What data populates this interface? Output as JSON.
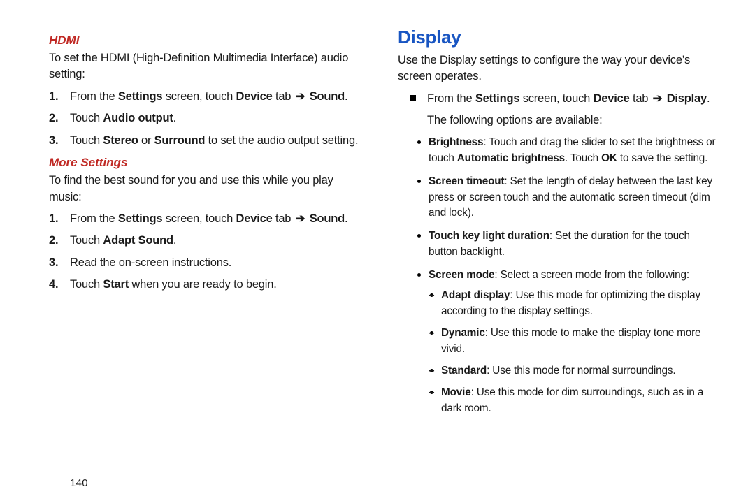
{
  "page_number": "140",
  "left": {
    "hdmi": {
      "heading": "HDMI",
      "intro": "To set the HDMI (High-Definition Multimedia Interface) audio setting:",
      "steps": [
        {
          "num": "1.",
          "pre": "From the ",
          "b1": "Settings",
          "mid1": " screen, touch ",
          "b2": "Device",
          "mid2": " tab ",
          "b3": "Sound",
          "post": "."
        },
        {
          "num": "2.",
          "pre": "Touch ",
          "b1": "Audio output",
          "post": "."
        },
        {
          "num": "3.",
          "pre": "Touch ",
          "b1": "Stereo",
          "mid1": " or ",
          "b2": "Surround",
          "post": " to set the audio output setting."
        }
      ]
    },
    "more": {
      "heading": "More Settings",
      "intro": "To find the best sound for you and use this while you play music:",
      "steps": [
        {
          "num": "1.",
          "pre": "From the ",
          "b1": "Settings",
          "mid1": " screen, touch ",
          "b2": "Device",
          "mid2": " tab ",
          "b3": "Sound",
          "post": "."
        },
        {
          "num": "2.",
          "pre": "Touch ",
          "b1": "Adapt Sound",
          "post": "."
        },
        {
          "num": "3.",
          "pre": "Read the on-screen instructions.",
          "post": ""
        },
        {
          "num": "4.",
          "pre": "Touch ",
          "b1": "Start",
          "post": " when you are ready to begin."
        }
      ]
    }
  },
  "right": {
    "display": {
      "heading": "Display",
      "intro": "Use the Display settings to configure the way your device’s screen operates.",
      "mainstep": {
        "pre": "From the ",
        "b1": "Settings",
        "mid1": " screen, touch ",
        "b2": "Device",
        "mid2": " tab ",
        "b3": "Display",
        "post": "."
      },
      "options_intro": "The following options are available:",
      "bullets": {
        "brightness": {
          "label": "Brightness",
          "text1": ": Touch and drag the slider to set the brightness or touch ",
          "b1": "Automatic brightness",
          "text2": ". Touch ",
          "b2": "OK",
          "text3": " to save the setting."
        },
        "timeout": {
          "label": "Screen timeout",
          "text": ": Set the length of delay between the last key press or screen touch and the automatic screen timeout (dim and lock)."
        },
        "touchkey": {
          "label": "Touch key light duration",
          "text": ": Set the duration for the touch button backlight."
        },
        "mode": {
          "label": "Screen mode",
          "text": ": Select a screen mode from the following:",
          "items": {
            "adapt": {
              "label": "Adapt display",
              "text": ": Use this mode for optimizing the display according to the display settings."
            },
            "dynamic": {
              "label": "Dynamic",
              "text": ": Use this mode to make the display tone more vivid."
            },
            "standard": {
              "label": "Standard",
              "text": ": Use this mode for normal surroundings."
            },
            "movie": {
              "label": "Movie",
              "text": ": Use this mode for dim surroundings, such as in a dark room."
            }
          }
        }
      }
    }
  },
  "arrow": "➔"
}
